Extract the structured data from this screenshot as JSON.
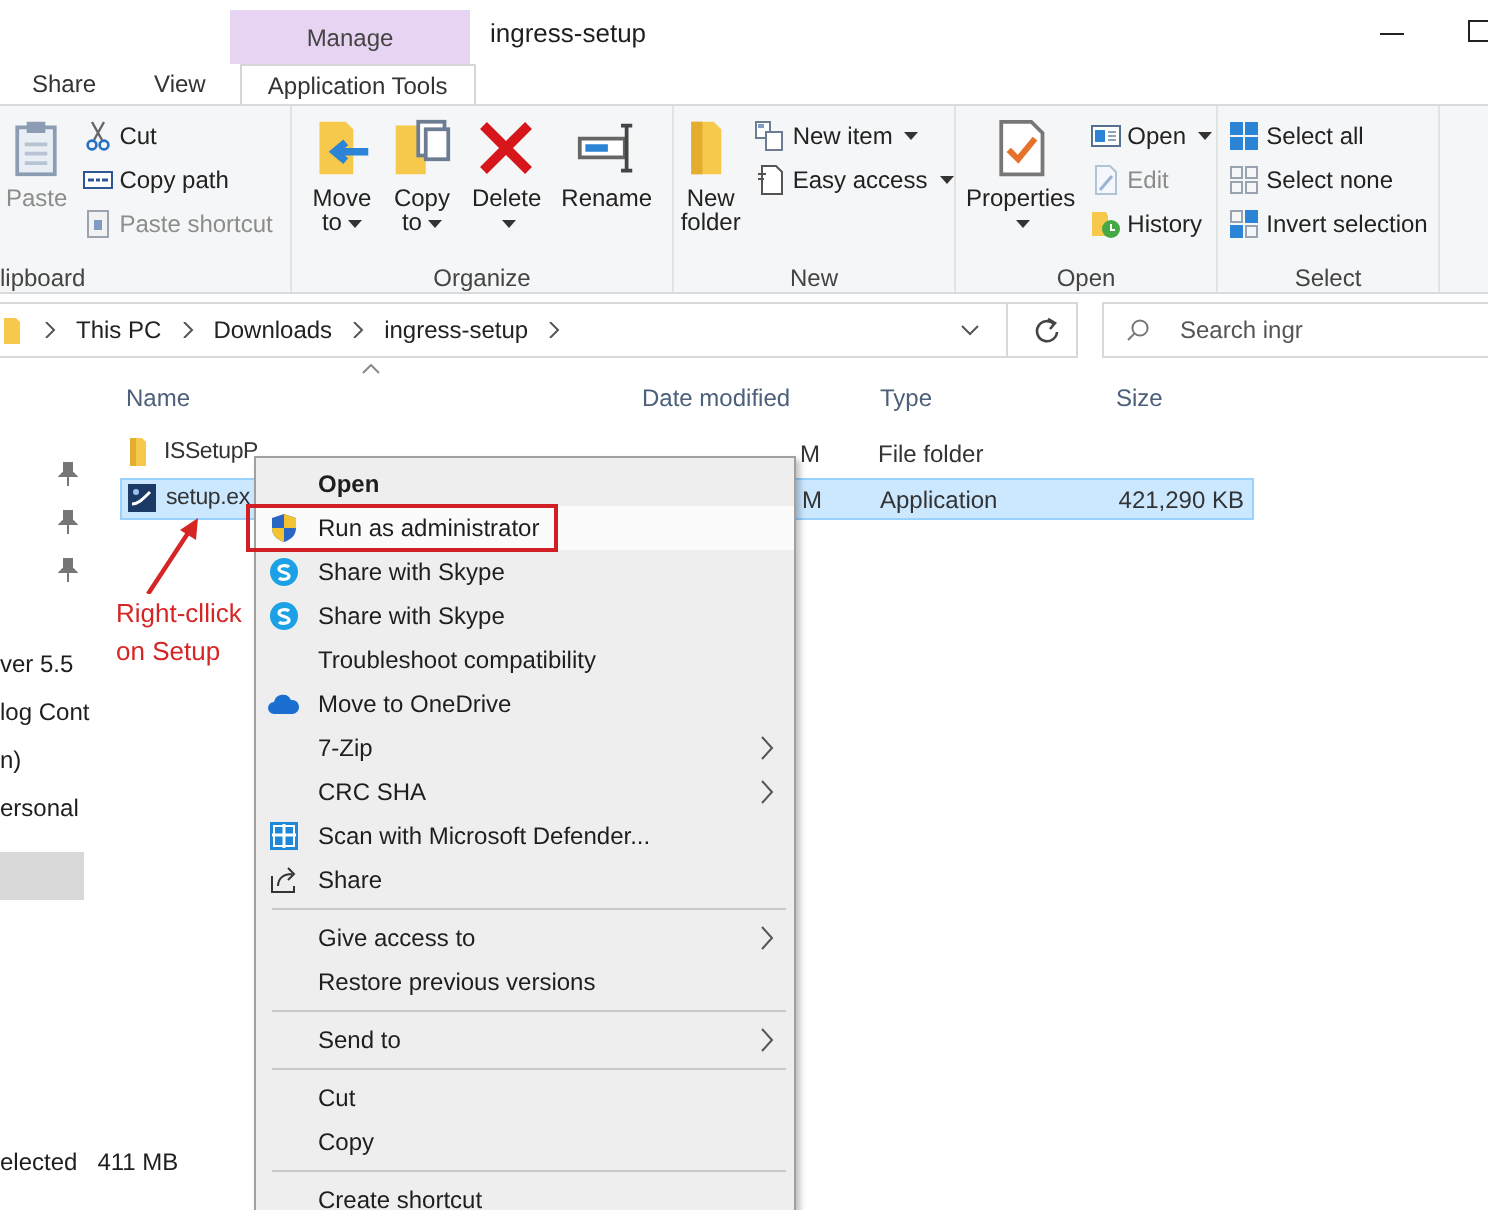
{
  "title_bar": {
    "context_tab": "Manage",
    "title": "ingress-setup"
  },
  "tabs": [
    {
      "label": "Share",
      "selected": false
    },
    {
      "label": "View",
      "selected": false
    },
    {
      "label": "Application Tools",
      "selected": true
    }
  ],
  "ribbon": {
    "groups": [
      {
        "label": "lipboard",
        "large": [
          {
            "label": "Paste",
            "kind": "clipboard",
            "disabled": true,
            "dropdown": false
          }
        ],
        "small": [
          {
            "label": "Cut",
            "kind": "scissors",
            "disabled": false,
            "dropdown": false
          },
          {
            "label": "Copy path",
            "kind": "path",
            "disabled": false,
            "dropdown": false
          },
          {
            "label": "Paste shortcut",
            "kind": "shortcut",
            "disabled": true,
            "dropdown": false
          }
        ]
      },
      {
        "label": "Organize",
        "large": [
          {
            "label": "Move to",
            "kind": "move_to",
            "disabled": false,
            "dropdown": true
          },
          {
            "label": "Copy to",
            "kind": "copy_to",
            "disabled": false,
            "dropdown": true
          },
          {
            "label": "Delete",
            "kind": "delete_x",
            "disabled": false,
            "dropdown": true
          },
          {
            "label": "Rename",
            "kind": "rename_field",
            "disabled": false,
            "dropdown": false
          }
        ]
      },
      {
        "label": "New",
        "large": [
          {
            "label": "New folder",
            "kind": "folder",
            "disabled": false,
            "dropdown": false
          }
        ],
        "small": [
          {
            "label": "New item",
            "kind": "new_doc",
            "disabled": false,
            "dropdown": true
          },
          {
            "label": "Easy access",
            "kind": "doc",
            "disabled": false,
            "dropdown": true
          }
        ]
      },
      {
        "label": "Open",
        "large": [
          {
            "label": "Properties",
            "kind": "check_page",
            "disabled": false,
            "dropdown": true
          }
        ],
        "small": [
          {
            "label": "Open",
            "kind": "window",
            "disabled": false,
            "dropdown": true
          },
          {
            "label": "Edit",
            "kind": "pencil",
            "disabled": true,
            "dropdown": false
          },
          {
            "label": "History",
            "kind": "clock",
            "disabled": false,
            "dropdown": false
          }
        ]
      },
      {
        "label": "Select",
        "small": [
          {
            "label": "Select all",
            "kind": "grid_full",
            "disabled": false,
            "dropdown": false
          },
          {
            "label": "Select none",
            "kind": "grid_empty",
            "disabled": false,
            "dropdown": false
          },
          {
            "label": "Invert selection",
            "kind": "grid_mixed",
            "disabled": false,
            "dropdown": false
          }
        ]
      }
    ]
  },
  "address": {
    "breadcrumbs": [
      "This PC",
      "Downloads",
      "ingress-setup"
    ]
  },
  "search": {
    "placeholder": "Search ingr"
  },
  "sidebar": {
    "items": [
      {
        "pinned": true,
        "selected": false
      },
      {
        "pinned": true,
        "selected": false
      },
      {
        "pinned": true,
        "selected": false
      },
      {
        "label": "ver 5.5",
        "pinned": false,
        "selected": false
      },
      {
        "label": "log Cont",
        "pinned": false,
        "selected": false
      },
      {
        "label": "n)",
        "pinned": false,
        "selected": false
      },
      {
        "label": "ersonal",
        "pinned": false,
        "selected": false
      },
      {
        "pinned": false,
        "selected": true
      }
    ]
  },
  "files": {
    "columns": [
      "Name",
      "Date modified",
      "Type",
      "Size"
    ],
    "rows": [
      {
        "name": "ISSetupP",
        "kind": "folder",
        "date": "M",
        "type": "File folder",
        "selected": false
      },
      {
        "name": "setup.ex",
        "kind": "app",
        "date": "M",
        "type": "Application",
        "size": "421,290 KB",
        "selected": true
      }
    ]
  },
  "context_menu": {
    "items": [
      {
        "kind": "plain",
        "label": "Open",
        "bold": true,
        "submenu": false,
        "selected": false,
        "outlined": false
      },
      {
        "kind": "shield",
        "label": "Run as administrator",
        "bold": false,
        "submenu": false,
        "selected": true,
        "outlined": true
      },
      {
        "kind": "skype",
        "label": "Share with Skype",
        "bold": false,
        "submenu": false,
        "selected": false,
        "outlined": false
      },
      {
        "kind": "skype",
        "label": "Share with Skype",
        "bold": false,
        "submenu": false,
        "selected": false,
        "outlined": false
      },
      {
        "kind": "plain",
        "label": "Troubleshoot compatibility",
        "bold": false,
        "submenu": false,
        "selected": false,
        "outlined": false
      },
      {
        "kind": "cloud",
        "label": "Move to OneDrive",
        "bold": false,
        "submenu": false,
        "selected": false,
        "outlined": false
      },
      {
        "kind": "plain",
        "label": "7-Zip",
        "bold": false,
        "submenu": true,
        "selected": false,
        "outlined": false
      },
      {
        "kind": "plain",
        "label": "CRC SHA",
        "bold": false,
        "submenu": true,
        "selected": false,
        "outlined": false
      },
      {
        "kind": "defender",
        "label": "Scan with Microsoft Defender...",
        "bold": false,
        "submenu": false,
        "selected": false,
        "outlined": false
      },
      {
        "kind": "share_arrow",
        "label": "Share",
        "bold": false,
        "submenu": false,
        "selected": false,
        "outlined": false
      },
      {
        "kind": "separator"
      },
      {
        "kind": "plain",
        "label": "Give access to",
        "bold": false,
        "submenu": true,
        "selected": false,
        "outlined": false
      },
      {
        "kind": "plain",
        "label": "Restore previous versions",
        "bold": false,
        "submenu": false,
        "selected": false,
        "outlined": false
      },
      {
        "kind": "separator"
      },
      {
        "kind": "plain",
        "label": "Send to",
        "bold": false,
        "submenu": true,
        "selected": false,
        "outlined": false
      },
      {
        "kind": "separator"
      },
      {
        "kind": "plain",
        "label": "Cut",
        "bold": false,
        "submenu": false,
        "selected": false,
        "outlined": false
      },
      {
        "kind": "plain",
        "label": "Copy",
        "bold": false,
        "submenu": false,
        "selected": false,
        "outlined": false
      },
      {
        "kind": "separator"
      },
      {
        "kind": "plain",
        "label": "Create shortcut",
        "bold": false,
        "submenu": false,
        "selected": false,
        "outlined": false
      }
    ]
  },
  "annotation": {
    "lines": [
      "Right-cllick",
      "on Setup"
    ]
  },
  "status_bar": [
    "elected",
    "411 MB"
  ]
}
